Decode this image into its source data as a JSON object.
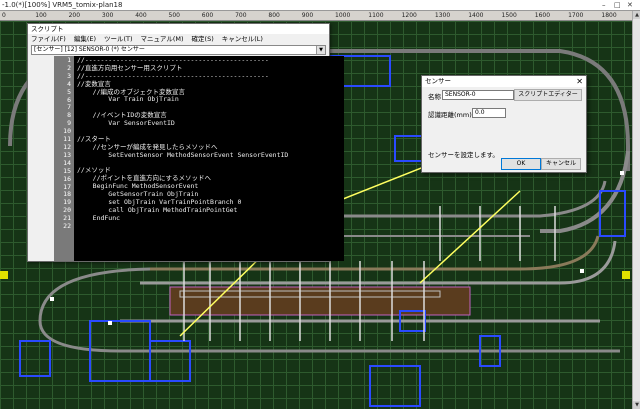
{
  "window": {
    "title": "-1.0(*)[100%] VRM5_tomix-plan18"
  },
  "ruler": {
    "ticks": [
      "0",
      "100",
      "200",
      "300",
      "400",
      "500",
      "600",
      "700",
      "800",
      "900",
      "1000",
      "1100",
      "1200",
      "1300",
      "1400",
      "1500",
      "1600",
      "1700",
      "1800"
    ]
  },
  "script_window": {
    "title": "スクリプト",
    "menu": [
      "ファイル(F)",
      "編集(E)",
      "ツール(T)",
      "マニュアル(M)",
      "確定(S)",
      "キャンセル(L)"
    ],
    "selector": "[センサー] [12] SENSOR-0 (*) センサー",
    "code_lines": [
      "//-----------------------------------------------",
      "//直進方向用センサー用スクリプト",
      "//-----------------------------------------------",
      "//変数宣言",
      "    //編成のオブジェクト変数宣言",
      "        Var Train ObjTrain",
      "",
      "    //イベントIDの変数宣言",
      "        Var SensorEventID",
      "",
      "//スタート",
      "    //センサーが編成を発見したらメソッドへ",
      "        SetEventSensor MethodSensorEvent SensorEventID",
      "",
      "//メソッド",
      "    //ポイントを直進方向にするメソッドへ",
      "    BeginFunc MethodSensorEvent",
      "        GetSensorTrain ObjTrain",
      "        set ObjTrain VarTrainPointBranch 0",
      "        call ObjTrain MethodTrainPointGet",
      "    EndFunc",
      ""
    ]
  },
  "sensor_dialog": {
    "title": "センサー",
    "name_label": "名称",
    "name_value": "SENSOR-0",
    "script_button": "スクリプトエディター",
    "distance_label": "認識距離(mm)",
    "distance_value": "0.0",
    "status": "センサーを設定します。",
    "ok": "OK",
    "cancel": "キャンセル"
  }
}
